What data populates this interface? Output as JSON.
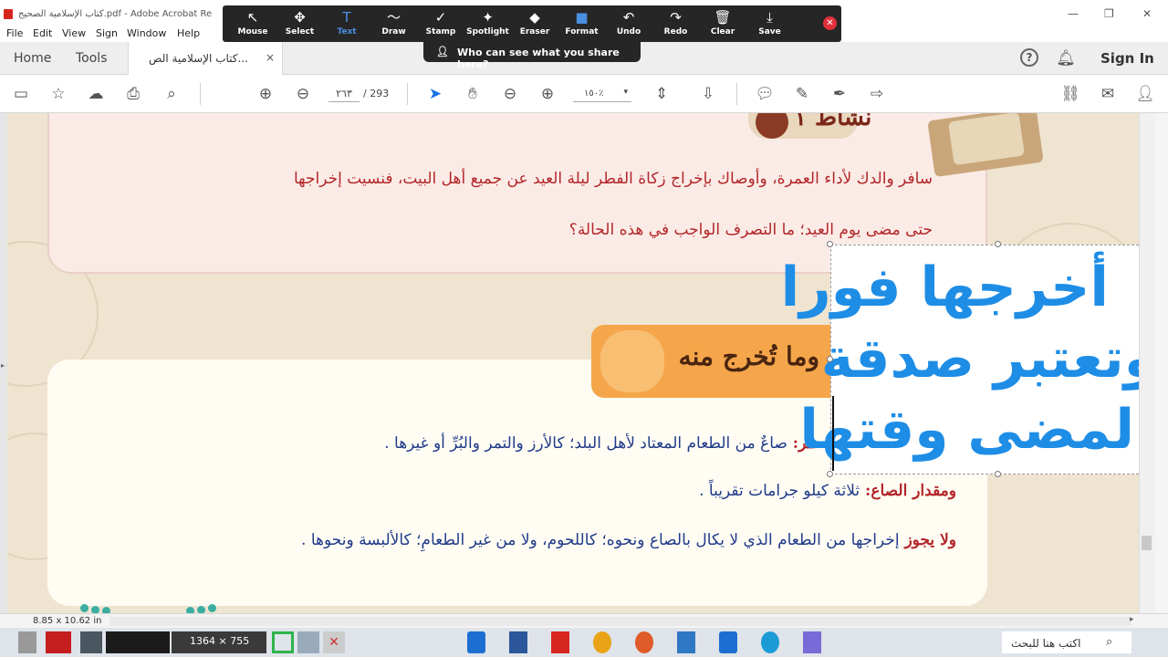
{
  "window": {
    "title": "كتاب الإسلامية الصحيح.pdf - Adobe Acrobat Re",
    "controls": [
      "—",
      "❐",
      "✕"
    ]
  },
  "menu": [
    "File",
    "Edit",
    "View",
    "Sign",
    "Window",
    "Help"
  ],
  "tabs": {
    "home": "Home",
    "tools": "Tools",
    "document": "كتاب الإسلامية الص...",
    "close": "×",
    "signin": "Sign In"
  },
  "toolbar": {
    "page_current": "٢٦٣",
    "page_total": "/  293",
    "zoom": "١٥٠٪"
  },
  "share_toolbar": {
    "tools": [
      {
        "label": "Mouse",
        "icon": "cursor-icon",
        "glyph": "↖"
      },
      {
        "label": "Select",
        "icon": "move-icon",
        "glyph": "✥"
      },
      {
        "label": "Text",
        "icon": "text-icon",
        "glyph": "T"
      },
      {
        "label": "Draw",
        "icon": "draw-icon",
        "glyph": "〜"
      },
      {
        "label": "Stamp",
        "icon": "stamp-icon",
        "glyph": "✓"
      },
      {
        "label": "Spotlight",
        "icon": "spotlight-icon",
        "glyph": "✦"
      },
      {
        "label": "Eraser",
        "icon": "eraser-icon",
        "glyph": "◆"
      },
      {
        "label": "Format",
        "icon": "format-icon",
        "glyph": "■"
      },
      {
        "label": "Undo",
        "icon": "undo-icon",
        "glyph": "↶"
      },
      {
        "label": "Redo",
        "icon": "redo-icon",
        "glyph": "↷"
      },
      {
        "label": "Clear",
        "icon": "trash-icon",
        "glyph": "🗑"
      },
      {
        "label": "Save",
        "icon": "save-icon",
        "glyph": "⤓"
      }
    ],
    "active_color": "#4a90e2",
    "close": "✕",
    "share_prompt": "Who can see what you share here?"
  },
  "document": {
    "activity_badge": "نشاط ١",
    "question_line1": "سافر والدك لأداء العمرة، وأوصاك بإخراج زكاة الفطر ليلة العيد عن جميع أهل البيت، فنسيت إخراجها",
    "question_line2": "حتى مضى يوم العيد؛ ما التصرف الواجب في هذه الحالة؟",
    "section_title": "وما تُخرج منه",
    "line1_bold": "طر: ",
    "line1_text": "صاعٌ من الطعام المعتاد لأهل البلد؛ كالأرز  والتمر والبُرِّ  أو غيرها .",
    "line2_bold": "ومقدار الصاع: ",
    "line2_text": "ثلاثة كيلو جرامات تقريباً .",
    "line3_bold": "ولا يجوز ",
    "line3_text": "إخراجها من الطعام الذي لا يكال بالصاع ونحوه؛ كاللحوم، ولا من غير الطعامِ؛ كالألبسة ونحوها ."
  },
  "annotation": {
    "lines": [
      "أخرجها فورا",
      "وتعتبر صدقة",
      "لمضى وقتها"
    ],
    "color": "#1e8de6"
  },
  "status": {
    "page_size": "8.85 x 10.62 in"
  },
  "taskbar": {
    "capture_size": "1364 × 755",
    "search_placeholder": "اكتب هنا للبحث"
  }
}
